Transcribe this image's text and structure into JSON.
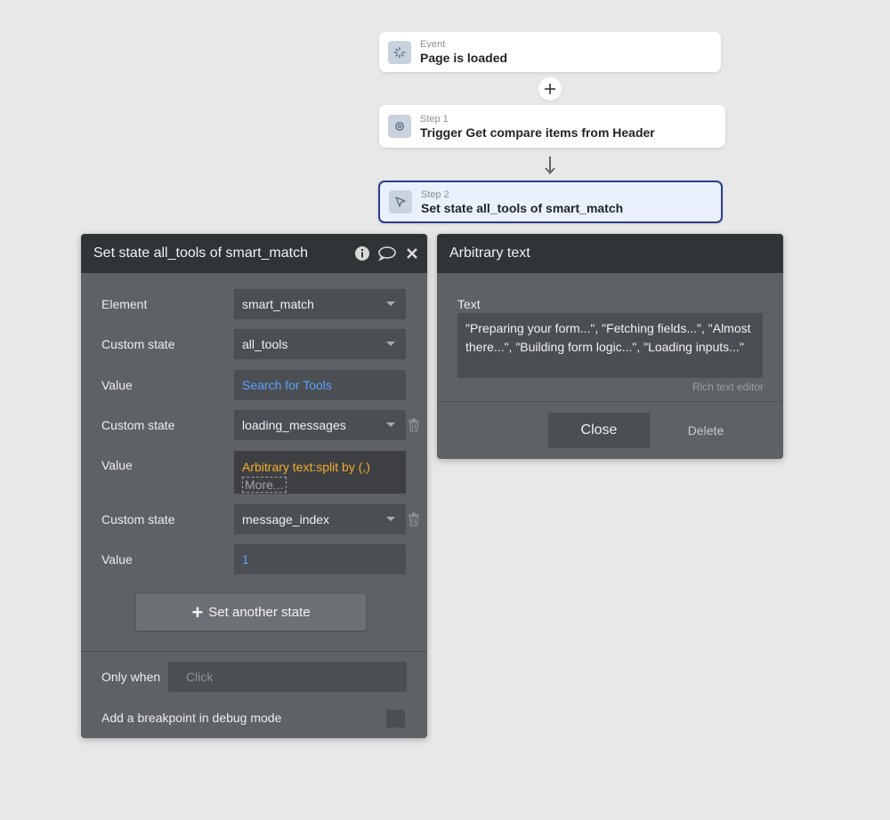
{
  "workflow": {
    "event": {
      "kicker": "Event",
      "title": "Page is loaded"
    },
    "step1": {
      "kicker": "Step 1",
      "title": "Trigger Get compare items from Header"
    },
    "step2": {
      "kicker": "Step 2",
      "title": "Set state all_tools of smart_match"
    }
  },
  "set_state_panel": {
    "title": "Set state all_tools of smart_match",
    "rows": [
      {
        "label": "Element",
        "value": "smart_match"
      },
      {
        "label": "Custom state",
        "value": "all_tools"
      },
      {
        "label": "Value",
        "value": "Search for Tools"
      },
      {
        "label": "Custom state",
        "value": "loading_messages"
      },
      {
        "label": "Value",
        "value": "Arbitrary text:split by (,)",
        "more": "More..."
      },
      {
        "label": "Custom state",
        "value": "message_index"
      },
      {
        "label": "Value",
        "value": "1"
      }
    ],
    "add_button": "Set another state",
    "only_when_label": "Only when",
    "only_when_placeholder": "Click",
    "breakpoint_label": "Add a breakpoint in debug mode"
  },
  "arbitrary_panel": {
    "title": "Arbitrary text",
    "text_label": "Text",
    "text_value": "\"Preparing your form...\", \"Fetching fields...\", \"Almost there...\", \"Building form logic...\", \"Loading inputs...\"",
    "rich_text_label": "Rich text editor",
    "close_button": "Close",
    "delete_button": "Delete"
  },
  "colors": {
    "panel_bg": "#5e6165",
    "header_bg": "#2f3437",
    "field_bg": "#4b4e52",
    "link": "#5aa3ff",
    "expression": "#f3ac2e",
    "selected_border": "#2a3d8f"
  }
}
